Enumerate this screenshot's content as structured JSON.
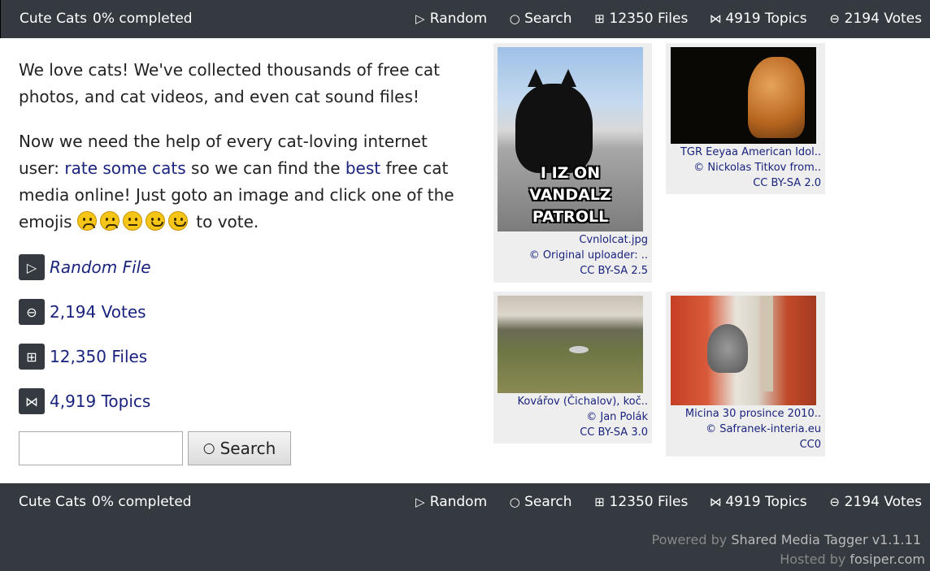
{
  "nav": {
    "title": "Cute Cats",
    "progress": "0% completed",
    "items": [
      {
        "icon": "play-icon",
        "glyph": "▷",
        "label": "Random"
      },
      {
        "icon": "search-icon",
        "glyph": "○",
        "label": "Search"
      },
      {
        "icon": "grid-icon",
        "glyph": "⊞",
        "label": "12350 Files"
      },
      {
        "icon": "bowtie-icon",
        "glyph": "⋈",
        "label": "4919 Topics"
      },
      {
        "icon": "vote-icon",
        "glyph": "⊖",
        "label": "2194 Votes"
      }
    ]
  },
  "intro": {
    "p1": "We love cats! We've collected thousands of free cat photos, and cat videos, and even cat sound files!",
    "p2_a": "Now we need the help of every cat-loving internet user: ",
    "p2_link1": "rate some cats",
    "p2_b": " so we can find the ",
    "p2_link2": "best",
    "p2_c": " free cat media online! Just goto an image and click one of the emojis ",
    "p2_d": " to vote.",
    "emojis": [
      "frowning-face",
      "slightly-frowning-face",
      "neutral-face",
      "slightly-smiling-face",
      "smiling-face"
    ]
  },
  "stats": {
    "random": {
      "icon": "play-icon",
      "glyph": "▷",
      "label": "Random File"
    },
    "votes": {
      "icon": "vote-icon",
      "glyph": "⊖",
      "label": "2,194 Votes"
    },
    "files": {
      "icon": "grid-icon",
      "glyph": "⊞",
      "label": "12,350 Files"
    },
    "topics": {
      "icon": "bowtie-icon",
      "glyph": "⋈",
      "label": "4,919 Topics"
    }
  },
  "search": {
    "button_label": "Search",
    "glyph": "○",
    "value": ""
  },
  "cards": [
    {
      "title": "Cvnlolcat.jpg",
      "credit": "© Original uploader: ..",
      "license": "CC BY-SA 2.5",
      "meme_text": "I IZ ON VANDALZ PATROLL"
    },
    {
      "title": "TGR Eeyaa American Idol..",
      "credit": "© Nickolas Titkov from..",
      "license": "CC BY-SA 2.0"
    },
    {
      "title": "Kovářov (Čichalov), koč..",
      "credit": "© Jan Polák",
      "license": "CC BY-SA 3.0"
    },
    {
      "title": "Micina 30 prosince 2010..",
      "credit": "© Safranek-interia.eu",
      "license": "CC0"
    }
  ],
  "footer": {
    "powered_prefix": "Powered by ",
    "powered_name": "Shared Media Tagger v1.1.11",
    "hosted_prefix": "Hosted by ",
    "hosted_name": "fosiper.com"
  },
  "colors": {
    "bar": "#343a40",
    "link": "#1a237e",
    "card_bg": "#eeeeee"
  }
}
